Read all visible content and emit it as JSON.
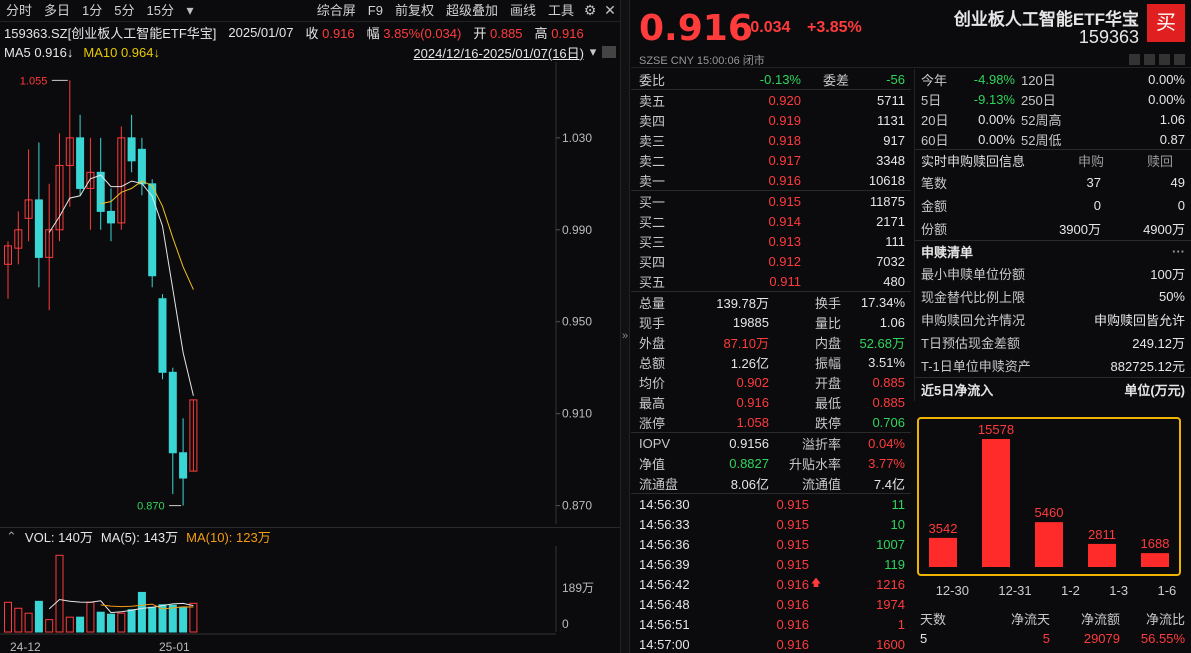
{
  "toolbar": {
    "left": [
      "分时",
      "多日",
      "1分",
      "5分",
      "15分"
    ],
    "right": [
      "综合屏",
      "F9",
      "前复权",
      "超级叠加",
      "画线",
      "工具"
    ]
  },
  "info": {
    "symbol": "159363.SZ[创业板人工智能ETF华宝]",
    "date": "2025/01/07",
    "close_label": "收",
    "close": "0.916",
    "amp_label": "幅",
    "amp": "3.85%(0.034)",
    "open_label": "开",
    "open": "0.885",
    "high_label": "高",
    "high": "0.916"
  },
  "ma": {
    "ma5": "MA5 0.916↓",
    "ma10": "MA10 0.964↓",
    "range": "2024/12/16-2025/01/07(16日)"
  },
  "kchart": {
    "hi_label": "1.055",
    "lo_label": "0.870",
    "ticks": [
      "1.030",
      "0.990",
      "0.950",
      "0.910",
      "0.870"
    ],
    "colors": {
      "up": "#ff3b3b",
      "down": "#3ad6d6",
      "ma5": "#e6e6e6",
      "ma10": "#f0c020",
      "ma20": "#f39c12"
    }
  },
  "candles": [
    {
      "o": 0.975,
      "h": 0.985,
      "l": 0.96,
      "c": 0.983
    },
    {
      "o": 0.982,
      "h": 0.998,
      "l": 0.975,
      "c": 0.99
    },
    {
      "o": 0.995,
      "h": 1.025,
      "l": 0.985,
      "c": 1.003
    },
    {
      "o": 1.003,
      "h": 1.028,
      "l": 0.965,
      "c": 0.978
    },
    {
      "o": 0.978,
      "h": 1.01,
      "l": 0.955,
      "c": 0.99
    },
    {
      "o": 0.99,
      "h": 1.032,
      "l": 0.985,
      "c": 1.018
    },
    {
      "o": 1.018,
      "h": 1.055,
      "l": 1.0,
      "c": 1.03
    },
    {
      "o": 1.03,
      "h": 1.04,
      "l": 1.005,
      "c": 1.008
    },
    {
      "o": 1.008,
      "h": 1.03,
      "l": 0.99,
      "c": 1.015
    },
    {
      "o": 1.015,
      "h": 1.03,
      "l": 0.99,
      "c": 0.998
    },
    {
      "o": 0.998,
      "h": 1.008,
      "l": 0.985,
      "c": 0.993
    },
    {
      "o": 0.993,
      "h": 1.035,
      "l": 0.99,
      "c": 1.03
    },
    {
      "o": 1.03,
      "h": 1.04,
      "l": 1.015,
      "c": 1.02
    },
    {
      "o": 1.025,
      "h": 1.03,
      "l": 1.005,
      "c": 1.01
    },
    {
      "o": 1.01,
      "h": 1.012,
      "l": 0.965,
      "c": 0.97
    },
    {
      "o": 0.96,
      "h": 0.962,
      "l": 0.925,
      "c": 0.928
    },
    {
      "o": 0.928,
      "h": 0.93,
      "l": 0.875,
      "c": 0.893
    },
    {
      "o": 0.893,
      "h": 0.908,
      "l": 0.87,
      "c": 0.882
    },
    {
      "o": 0.885,
      "h": 0.916,
      "l": 0.885,
      "c": 0.916
    }
  ],
  "vol": {
    "label": "VOL: 140万",
    "ma5": "MA(5): 143万",
    "ma10": "MA(10): 123万",
    "ymax_label": "189万",
    "zero": "0",
    "x_labels": [
      "24-12",
      "25-01"
    ],
    "values": [
      60,
      48,
      38,
      62,
      25,
      155,
      30,
      30,
      60,
      40,
      36,
      38,
      45,
      80,
      50,
      55,
      54,
      50,
      58
    ]
  },
  "quote": {
    "price": "0.916",
    "change": "+0.034",
    "pct": "+3.85%",
    "name": "创业板人工智能ETF华宝",
    "code": "159363",
    "buy": "买",
    "market": "SZSE  CNY  15:00:06  闭市"
  },
  "book": {
    "ratio": {
      "l1": "委比",
      "v1": "-0.13%",
      "l2": "委差",
      "v2": "-56"
    },
    "asks": [
      {
        "l": "卖五",
        "p": "0.920",
        "v": "5711"
      },
      {
        "l": "卖四",
        "p": "0.919",
        "v": "1131"
      },
      {
        "l": "卖三",
        "p": "0.918",
        "v": "917"
      },
      {
        "l": "卖二",
        "p": "0.917",
        "v": "3348"
      },
      {
        "l": "卖一",
        "p": "0.916",
        "v": "10618"
      }
    ],
    "bids": [
      {
        "l": "买一",
        "p": "0.915",
        "v": "11875"
      },
      {
        "l": "买二",
        "p": "0.914",
        "v": "2171"
      },
      {
        "l": "买三",
        "p": "0.913",
        "v": "111"
      },
      {
        "l": "买四",
        "p": "0.912",
        "v": "7032"
      },
      {
        "l": "买五",
        "p": "0.911",
        "v": "480"
      }
    ]
  },
  "stats": [
    {
      "l1": "总量",
      "v1": "139.78万",
      "c1": "white",
      "l2": "换手",
      "v2": "17.34%",
      "c2": "white"
    },
    {
      "l1": "现手",
      "v1": "19885",
      "c1": "white",
      "l2": "量比",
      "v2": "1.06",
      "c2": "white"
    },
    {
      "l1": "外盘",
      "v1": "87.10万",
      "c1": "red",
      "l2": "内盘",
      "v2": "52.68万",
      "c2": "green"
    },
    {
      "l1": "总额",
      "v1": "1.26亿",
      "c1": "white",
      "l2": "振幅",
      "v2": "3.51%",
      "c2": "white"
    },
    {
      "l1": "均价",
      "v1": "0.902",
      "c1": "red",
      "l2": "开盘",
      "v2": "0.885",
      "c2": "red"
    },
    {
      "l1": "最高",
      "v1": "0.916",
      "c1": "red",
      "l2": "最低",
      "v2": "0.885",
      "c2": "red"
    },
    {
      "l1": "涨停",
      "v1": "1.058",
      "c1": "red",
      "l2": "跌停",
      "v2": "0.706",
      "c2": "green"
    }
  ],
  "stats2": [
    {
      "l1": "IOPV",
      "v1": "0.9156",
      "c1": "white",
      "l2": "溢折率",
      "v2": "0.04%",
      "c2": "red"
    },
    {
      "l1": "净值",
      "v1": "0.8827",
      "c1": "green",
      "l2": "升贴水率",
      "v2": "3.77%",
      "c2": "red"
    },
    {
      "l1": "流通盘",
      "v1": "8.06亿",
      "c1": "white",
      "l2": "流通值",
      "v2": "7.4亿",
      "c2": "white"
    }
  ],
  "ticks": [
    {
      "t": "14:56:30",
      "p": "0.915",
      "v": "11",
      "vc": "green",
      "arrow": ""
    },
    {
      "t": "14:56:33",
      "p": "0.915",
      "v": "10",
      "vc": "green",
      "arrow": ""
    },
    {
      "t": "14:56:36",
      "p": "0.915",
      "v": "1007",
      "vc": "green",
      "arrow": ""
    },
    {
      "t": "14:56:39",
      "p": "0.915",
      "v": "119",
      "vc": "green",
      "arrow": ""
    },
    {
      "t": "14:56:42",
      "p": "0.916",
      "v": "1216",
      "vc": "red",
      "arrow": "🡅"
    },
    {
      "t": "14:56:48",
      "p": "0.916",
      "v": "1974",
      "vc": "red",
      "arrow": ""
    },
    {
      "t": "14:56:51",
      "p": "0.916",
      "v": "1",
      "vc": "red",
      "arrow": ""
    },
    {
      "t": "14:57:00",
      "p": "0.916",
      "v": "1600",
      "vc": "red",
      "arrow": ""
    }
  ],
  "perf": [
    {
      "a": "今年",
      "b": "-4.98%",
      "bc": "green",
      "c": "120日",
      "d": "0.00%"
    },
    {
      "a": "5日",
      "b": "-9.13%",
      "bc": "green",
      "c": "250日",
      "d": "0.00%"
    },
    {
      "a": "20日",
      "b": "0.00%",
      "bc": "white",
      "c": "52周高",
      "d": "1.06"
    },
    {
      "a": "60日",
      "b": "0.00%",
      "bc": "white",
      "c": "52周低",
      "d": "0.87"
    }
  ],
  "realtime": {
    "title": "实时申购赎回信息",
    "h1": "申购",
    "h2": "赎回",
    "rows": [
      {
        "l": "笔数",
        "a": "37",
        "b": "49"
      },
      {
        "l": "金额",
        "a": "0",
        "b": "0"
      },
      {
        "l": "份额",
        "a": "3900万",
        "b": "4900万"
      }
    ]
  },
  "list": {
    "title": "申赎清单",
    "more": "···",
    "rows": [
      {
        "l": "最小申赎单位份额",
        "v": "100万"
      },
      {
        "l": "现金替代比例上限",
        "v": "50%"
      },
      {
        "l": "申购赎回允许情况",
        "v": "申购赎回皆允许"
      },
      {
        "l": "T日预估现金差额",
        "v": "249.12万"
      },
      {
        "l": "T-1日单位申赎资产",
        "v": "882725.12元"
      }
    ]
  },
  "flow": {
    "title": "近5日净流入",
    "unit": "单位(万元)",
    "color": "#ff2a2a"
  },
  "chart_data": {
    "type": "bar",
    "categories": [
      "12-30",
      "12-31",
      "1-2",
      "1-3",
      "1-6"
    ],
    "values": [
      3542,
      15578,
      5460,
      2811,
      1688
    ],
    "title": "近5日净流入",
    "ylabel": "单位(万元)"
  },
  "flowtbl": {
    "headers": [
      "天数",
      "净流天",
      "净流额",
      "净流比"
    ],
    "row": [
      "5",
      "5",
      "29079",
      "56.55%"
    ]
  }
}
